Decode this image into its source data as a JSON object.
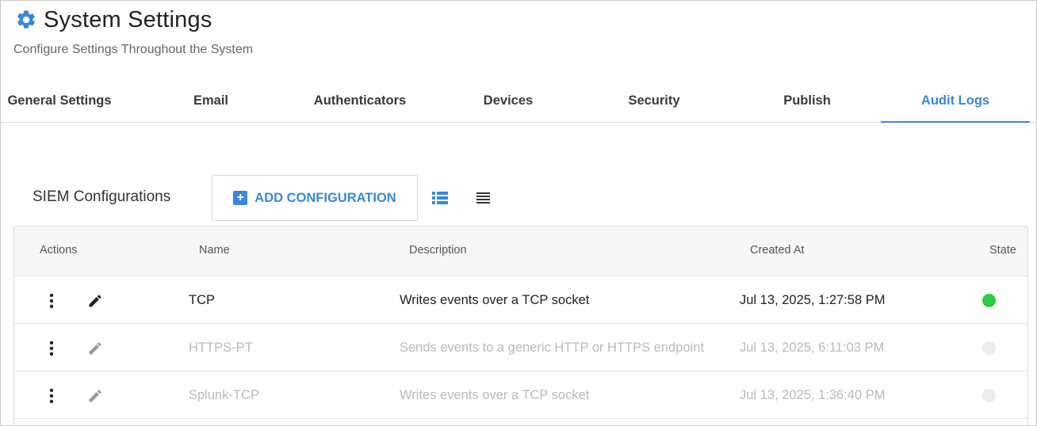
{
  "header": {
    "title": "System Settings",
    "subtitle": "Configure Settings Throughout the System",
    "icon": "gear-icon"
  },
  "tabs": [
    {
      "label": "General Settings",
      "active": false
    },
    {
      "label": "Email",
      "active": false
    },
    {
      "label": "Authenticators",
      "active": false
    },
    {
      "label": "Devices",
      "active": false
    },
    {
      "label": "Security",
      "active": false
    },
    {
      "label": "Publish",
      "active": false
    },
    {
      "label": "Audit Logs",
      "active": true
    }
  ],
  "siem": {
    "label": "SIEM Configurations",
    "add_button": "ADD CONFIGURATION"
  },
  "table": {
    "columns": [
      "Actions",
      "Name",
      "Description",
      "Created At",
      "State"
    ],
    "rows": [
      {
        "name": "TCP",
        "description": "Writes events over a TCP socket",
        "created_at": "Jul 13, 2025, 1:27:58 PM",
        "state": "active"
      },
      {
        "name": "HTTPS-PT",
        "description": "Sends events to a generic HTTP or HTTPS endpoint",
        "created_at": "Jul 13, 2025, 6:11:03 PM",
        "state": "inactive"
      },
      {
        "name": "Splunk-TCP",
        "description": "Writes events over a TCP socket",
        "created_at": "Jul 13, 2025, 1:36:40 PM",
        "state": "inactive"
      }
    ]
  },
  "colors": {
    "accent": "#3b87d8",
    "state_active": "#2ecc40",
    "state_inactive": "#ececec"
  }
}
